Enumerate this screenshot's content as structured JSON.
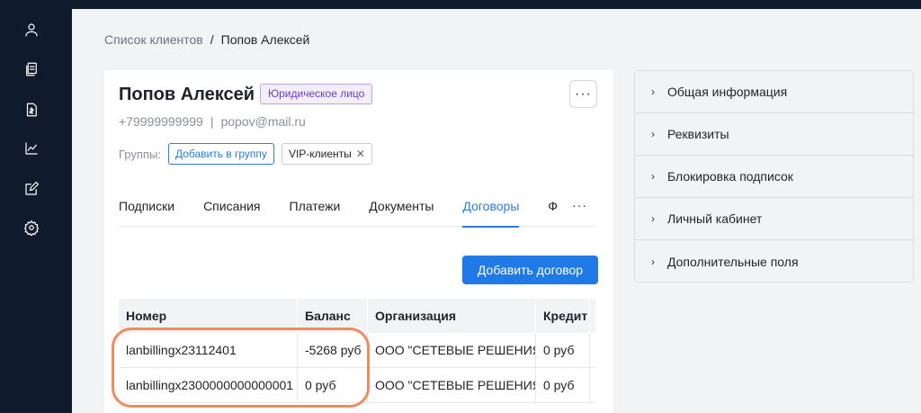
{
  "sidebar": {
    "items": [
      {
        "icon": "user-icon"
      },
      {
        "icon": "documents-icon"
      },
      {
        "icon": "invoice-icon"
      },
      {
        "icon": "chart-icon"
      },
      {
        "icon": "edit-icon"
      },
      {
        "icon": "gear-icon"
      }
    ]
  },
  "breadcrumb": {
    "parent": "Список клиентов",
    "separator": "/",
    "current": "Попов Алексей"
  },
  "client": {
    "name": "Попов Алексей",
    "type_badge": "Юридическое лицо",
    "more_label": "···",
    "phone": "+79999999999",
    "contact_separator": "|",
    "email": "popov@mail.ru",
    "groups_label": "Группы:",
    "add_group_label": "Добавить в группу",
    "group_chip": "VIP-клиенты",
    "chip_remove": "✕"
  },
  "tabs": {
    "items": [
      "Подписки",
      "Списания",
      "Платежи",
      "Документы",
      "Договоры",
      "Ф"
    ],
    "active_index": 4,
    "more_label": "···"
  },
  "contracts": {
    "add_button": "Добавить договор",
    "columns": [
      "Номер",
      "Баланс",
      "Организация",
      "Кредит"
    ],
    "rows": [
      [
        "lanbillingx23112401",
        "-5268 руб",
        "ООО \"СЕТЕВЫЕ РЕШЕНИЯ\"",
        "0 руб"
      ],
      [
        "lanbillingx2300000000000001",
        "0 руб",
        "ООО \"СЕТЕВЫЕ РЕШЕНИЯ\"",
        "0 руб"
      ]
    ]
  },
  "side_panel": {
    "chevron": "›",
    "sections": [
      "Общая информация",
      "Реквизиты",
      "Блокировка подписок",
      "Личный кабинет",
      "Дополнительные поля"
    ]
  },
  "colors": {
    "sidebar_bg": "#0f1b2d",
    "accent": "#1f7ae8",
    "badge_purple": "#6b3fc7",
    "highlight": "#f08a60"
  }
}
